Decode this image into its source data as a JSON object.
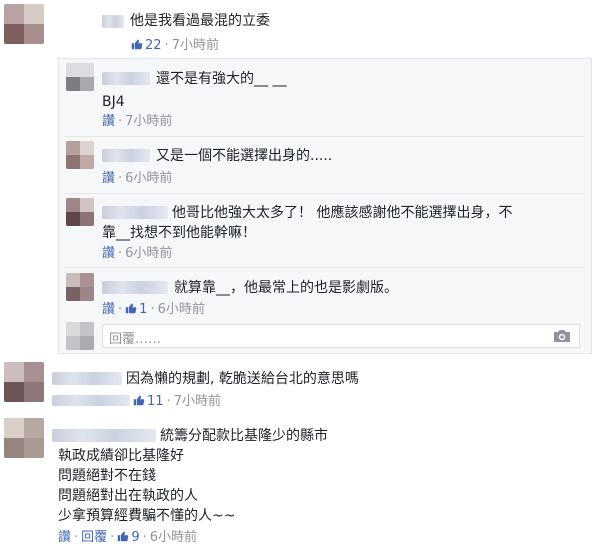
{
  "icons": {
    "like": "thumbs-up-icon",
    "camera": "camera-icon"
  },
  "colors": {
    "link": "#4267b2",
    "meta_gray": "#90949c",
    "text": "#1d2129",
    "reply_bg": "#f6f7f9"
  },
  "comment1": {
    "text": "他是我看過最混的立委",
    "likes": "22",
    "time": "7小時前"
  },
  "reply1": {
    "line1": "還不是有強大的__ __",
    "line2": "BJ4",
    "like_label": "讚",
    "time": "7小時前"
  },
  "reply2": {
    "text": "又是一個不能選擇出身的.....",
    "like_label": "讚",
    "time": "6小時前"
  },
  "reply3": {
    "line1": "他哥比他強大太多了！ 他應該感謝他不能選擇出身，不",
    "line2": "靠__找想不到他能幹嘛！",
    "like_label": "讚",
    "time": "6小時前"
  },
  "reply4": {
    "text": "就算靠__，他最常上的也是影劇版。",
    "like_label": "讚",
    "likes": "1",
    "time": "6小時前"
  },
  "reply_box": {
    "placeholder": "回覆……"
  },
  "comment2": {
    "text": "因為懶的規劃, 乾脆送給台北的意思嗎",
    "likes": "11",
    "time": "7小時前"
  },
  "comment3": {
    "line1": "統籌分配款比基隆少的縣市",
    "line2": "執政成績卻比基隆好",
    "line3": "問題絕對不在錢",
    "line4": "問題絕對出在執政的人",
    "line5": "少拿預算經費騙不懂的人~~",
    "like_label": "讚",
    "reply_label": "回覆",
    "likes": "9",
    "time": "6小時前"
  }
}
